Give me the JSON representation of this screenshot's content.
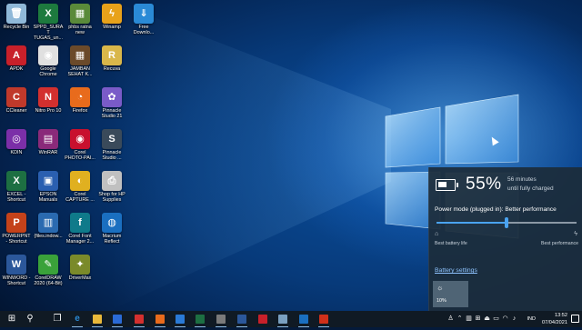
{
  "desktop": {
    "icons": [
      {
        "label": "Recycle Bin",
        "color": "#8fb8d8",
        "glyph": "🗑"
      },
      {
        "label": "SPPD_SURAT TUGAS_un...",
        "color": "#1d7a3e",
        "glyph": "X"
      },
      {
        "label": "phbs ratna new",
        "color": "#5a8a3a",
        "glyph": "▦"
      },
      {
        "label": "Winamp",
        "color": "#e8a21a",
        "glyph": "ϟ"
      },
      {
        "label": "Free Downlo...",
        "color": "#2a8ad6",
        "glyph": "⇓"
      },
      {
        "label": "APDK",
        "color": "#c8202a",
        "glyph": "A"
      },
      {
        "label": "Google Chrome",
        "color": "#e0e0e0",
        "glyph": "◉"
      },
      {
        "label": "JAMBAN SEHAT K...",
        "color": "#6b4a2a",
        "glyph": "▦"
      },
      {
        "label": "Recuva",
        "color": "#d9b74a",
        "glyph": "R"
      },
      {
        "label": "CCleaner",
        "color": "#c0392b",
        "glyph": "C"
      },
      {
        "label": "Nitro Pro 10",
        "color": "#d3302f",
        "glyph": "N"
      },
      {
        "label": "Firefox",
        "color": "#e86b1c",
        "glyph": "◔"
      },
      {
        "label": "Pinnacle Studio 21",
        "color": "#7a5bc8",
        "glyph": "✿"
      },
      {
        "label": "KDIN",
        "color": "#7b2fa8",
        "glyph": "◎"
      },
      {
        "label": "WinRAR",
        "color": "#8a2a7a",
        "glyph": "▤"
      },
      {
        "label": "Corel PHOTO-PAI...",
        "color": "#c8102e",
        "glyph": "◉"
      },
      {
        "label": "Pinnacle Studio ...",
        "color": "#3a4a5a",
        "glyph": "S"
      },
      {
        "label": "EXCEL - Shortcut",
        "color": "#1d6f42",
        "glyph": "X"
      },
      {
        "label": "EPSON Manuals",
        "color": "#2a5fb0",
        "glyph": "▣"
      },
      {
        "label": "Corel CAPTURE ...",
        "color": "#e0b020",
        "glyph": "◐"
      },
      {
        "label": "Shop for HP Supplies",
        "color": "#c0c0c0",
        "glyph": "⎙"
      },
      {
        "label": "POWERPNT - Shortcut",
        "color": "#c4421a",
        "glyph": "P"
      },
      {
        "label": "{files.indow...",
        "color": "#2a6ab0",
        "glyph": "▥"
      },
      {
        "label": "Corel Font Manager 2...",
        "color": "#0f7a8a",
        "glyph": "f"
      },
      {
        "label": "Macrium Reflect",
        "color": "#1a6fc0",
        "glyph": "◍"
      },
      {
        "label": "WINWORD - Shortcut",
        "color": "#2b579a",
        "glyph": "W"
      },
      {
        "label": "CorelDRAW 2020 (64-Bit)",
        "color": "#3aa23a",
        "glyph": "✎"
      },
      {
        "label": "DriverMax",
        "color": "#7a8a2a",
        "glyph": "✦"
      }
    ]
  },
  "battery_flyout": {
    "percent": "55%",
    "percent_value": 55,
    "minutes": "56 minutes",
    "status": "until fully charged",
    "power_mode": "Power mode (plugged in): Better performance",
    "slider_position_pct": 50,
    "left_label": "Best battery life",
    "right_label": "Best performance",
    "settings_link": "Battery settings",
    "brightness": "10%"
  },
  "taskbar": {
    "apps": [
      {
        "name": "start-button",
        "glyph": "⊞",
        "color": ""
      },
      {
        "name": "search-icon",
        "glyph": "⚲",
        "color": ""
      },
      {
        "name": "task-view-icon",
        "glyph": "❐",
        "color": ""
      },
      {
        "name": "edge-icon",
        "glyph": "e",
        "color": "#2a8ad6"
      },
      {
        "name": "file-explorer-icon",
        "glyph": "",
        "color": "#e8b83a"
      },
      {
        "name": "store-icon",
        "glyph": "",
        "color": "#2a6ad6"
      },
      {
        "name": "nitro-icon",
        "glyph": "",
        "color": "#d3302f"
      },
      {
        "name": "firefox-icon",
        "glyph": "",
        "color": "#e86b1c"
      },
      {
        "name": "mail-icon",
        "glyph": "",
        "color": "#2a7ad6"
      },
      {
        "name": "excel-icon",
        "glyph": "",
        "color": "#1d6f42"
      },
      {
        "name": "settings-icon",
        "glyph": "",
        "color": "#7a7a7a"
      },
      {
        "name": "word-icon",
        "glyph": "",
        "color": "#2b579a"
      },
      {
        "name": "photo-icon",
        "glyph": "",
        "color": "#c8202a"
      },
      {
        "name": "app-icon-1",
        "glyph": "",
        "color": "#7aa0c0"
      },
      {
        "name": "windows-icon",
        "glyph": "",
        "color": "#1a6fc0"
      },
      {
        "name": "screenshot-icon",
        "glyph": "",
        "color": "#d0301a"
      }
    ],
    "language": "IND",
    "time": "13:52",
    "date": "07/04/2021"
  },
  "colors": {
    "accent": "#4aa3f0",
    "link": "#8fc4ff",
    "flyout_bg": "#1c2c3a",
    "taskbar_bg": "#101a24"
  }
}
